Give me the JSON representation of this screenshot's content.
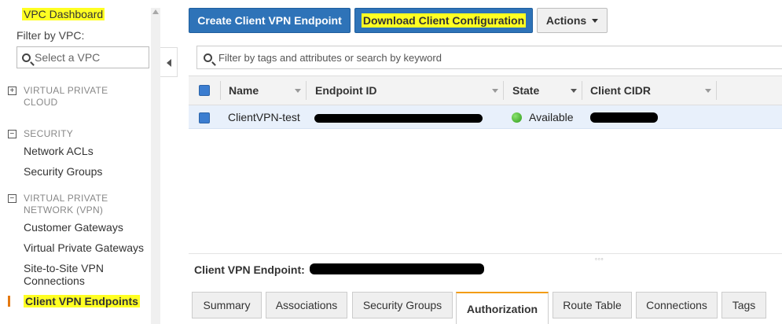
{
  "sidebar": {
    "dashboard": "VPC Dashboard",
    "filter_label": "Filter by VPC:",
    "select_placeholder": "Select a VPC",
    "sections": [
      {
        "toggle": "+",
        "title_line1": "VIRTUAL PRIVATE",
        "title_line2": "CLOUD"
      },
      {
        "toggle": "−",
        "title_line1": "SECURITY",
        "title_line2": ""
      },
      {
        "toggle": "−",
        "title_line1": "VIRTUAL PRIVATE",
        "title_line2": "NETWORK (VPN)"
      }
    ],
    "security_items": [
      "Network ACLs",
      "Security Groups"
    ],
    "vpn_items": [
      "Customer Gateways",
      "Virtual Private Gateways",
      "Site-to-Site VPN",
      "Connections",
      "Client VPN Endpoints"
    ]
  },
  "toolbar": {
    "create_label": "Create Client VPN Endpoint",
    "download_label": "Download Client Configuration",
    "actions_label": "Actions"
  },
  "search": {
    "placeholder": "Filter by tags and attributes or search by keyword"
  },
  "table": {
    "columns": [
      "Name",
      "Endpoint ID",
      "State",
      "Client CIDR"
    ],
    "rows": [
      {
        "name": "ClientVPN-test",
        "endpoint_id": "",
        "state": "Available",
        "client_cidr": ""
      }
    ]
  },
  "detail": {
    "label": "Client VPN Endpoint:"
  },
  "tabs": [
    "Summary",
    "Associations",
    "Security Groups",
    "Authorization",
    "Route Table",
    "Connections",
    "Tags"
  ],
  "colors": {
    "primary": "#2e73b8",
    "highlight": "#ffff22",
    "active_tab_accent": "#f39c12",
    "available": "#2e9b1a"
  }
}
